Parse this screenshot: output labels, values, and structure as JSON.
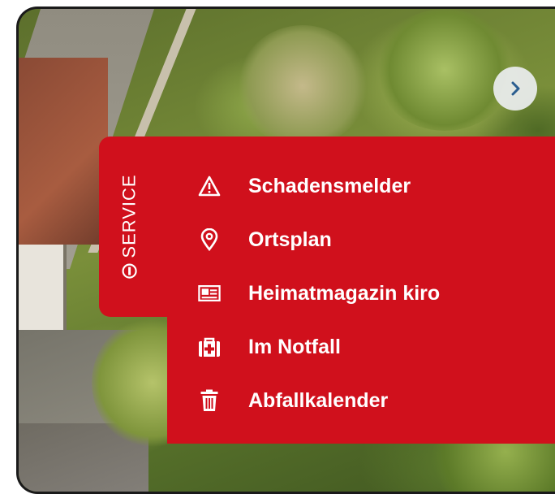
{
  "service_tab": {
    "label": "SERVICE",
    "icon": "service-info-icon"
  },
  "carousel": {
    "next_icon": "chevron-right-icon"
  },
  "menu": {
    "items": [
      {
        "label": "Schadensmelder",
        "icon": "warning-triangle-icon"
      },
      {
        "label": "Ortsplan",
        "icon": "map-pin-icon"
      },
      {
        "label": "Heimatmagazin kiro",
        "icon": "id-card-icon"
      },
      {
        "label": "Im Notfall",
        "icon": "first-aid-kit-icon"
      },
      {
        "label": "Abfallkalender",
        "icon": "trash-bin-icon"
      }
    ]
  },
  "colors": {
    "accent": "#d0101c",
    "text": "#ffffff",
    "chevron": "#2a5d8f"
  }
}
